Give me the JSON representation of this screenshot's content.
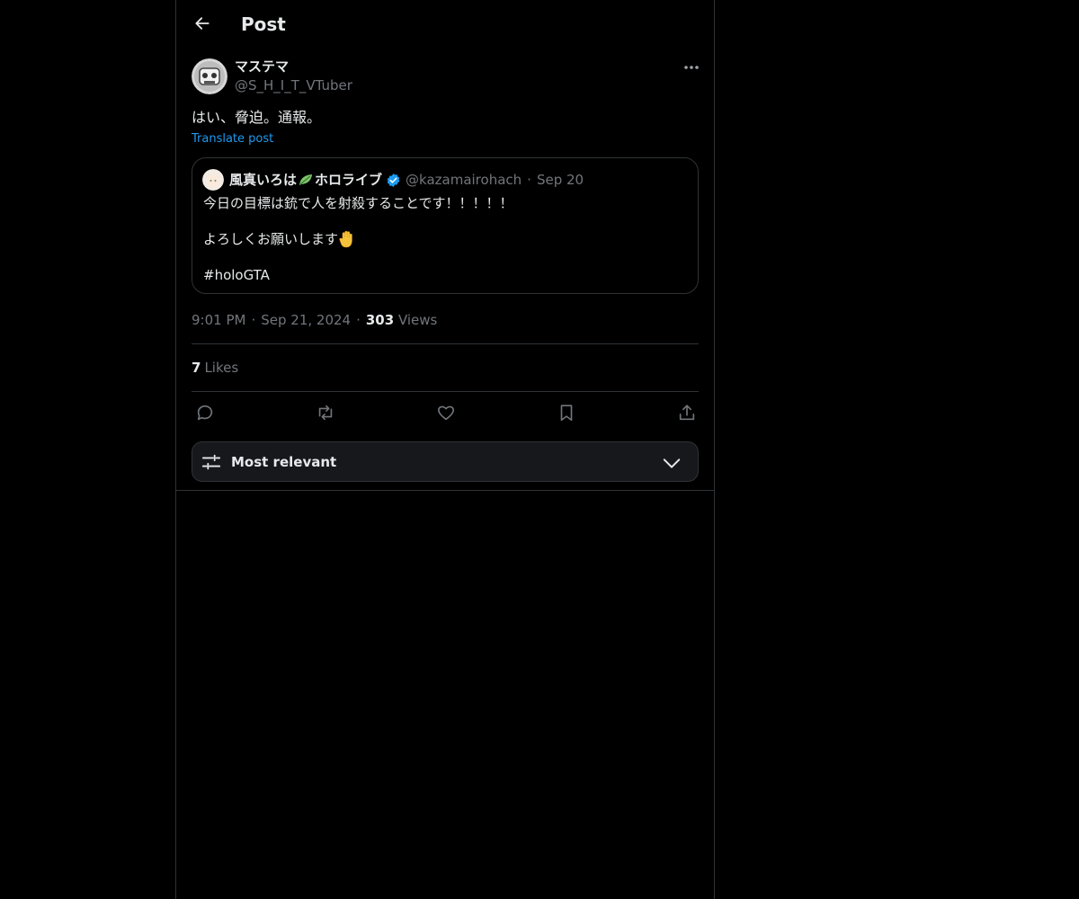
{
  "header": {
    "title": "Post"
  },
  "post": {
    "author": {
      "name": "マステマ",
      "handle": "@S_H_I_T_VTuber"
    },
    "text": "はい、脅迫。通報。",
    "translate_label": "Translate post",
    "time": "9:01 PM",
    "date": "Sep 21, 2024",
    "separator": "·",
    "views_count": "303",
    "views_label": "Views",
    "likes_count": "7",
    "likes_label": "Likes"
  },
  "quote": {
    "author": {
      "name": "風真いろは",
      "name_suffix": "ホロライブ",
      "handle": "@kazamairohach",
      "verified": true
    },
    "separator": "·",
    "date": "Sep 20",
    "line1": "今日の目標は銃で人を射殺することです！！！！！",
    "line2": "よろしくお願いします",
    "line3": "#holoGTA"
  },
  "actions": {
    "reply": "reply-icon",
    "repost": "repost-icon",
    "like": "heart-icon",
    "bookmark": "bookmark-icon",
    "share": "share-icon"
  },
  "sort": {
    "label": "Most relevant"
  },
  "colors": {
    "background": "#000000",
    "border": "#2f3336",
    "text": "#e7e9ea",
    "muted": "#71767b",
    "accent": "#1d9bf0",
    "sort_bar_bg": "#16181c"
  }
}
